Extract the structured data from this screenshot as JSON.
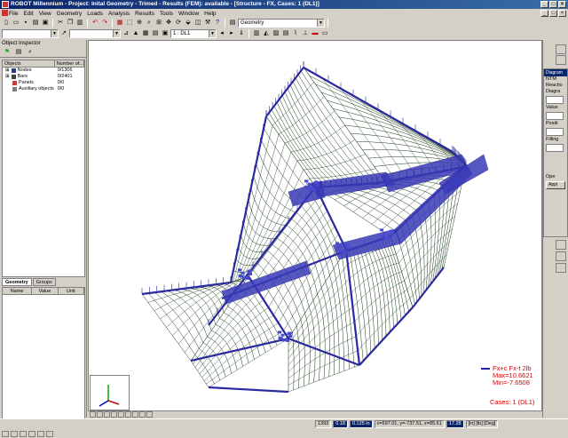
{
  "window": {
    "title": "ROBOT Millennium - Project: Inital Geometry - Trimed - Results (FEM): available - [Structure - FX, Cases: 1 (DL1)]",
    "controls": [
      "_",
      "□",
      "×"
    ]
  },
  "menu": {
    "items": [
      "File",
      "Edit",
      "View",
      "Geometry",
      "Loads",
      "Analysis",
      "Results",
      "Tools",
      "Window",
      "Help"
    ]
  },
  "toolbar": {
    "layout_select": "Geometry",
    "case_select": "1 : DL1"
  },
  "object_inspector": {
    "title": "Object Inspector",
    "columns": [
      "Objects",
      "Number of..."
    ],
    "rows": [
      {
        "name": "Nodes",
        "count": "0/1306",
        "icon_color": "#2040a0"
      },
      {
        "name": "Bars",
        "count": "0/2401",
        "icon_color": "#404040"
      },
      {
        "name": "Panels",
        "count": "0/0",
        "icon_color": "#c04040"
      },
      {
        "name": "Auxiliary objects",
        "count": "0/0",
        "icon_color": "#808080"
      }
    ],
    "tabs": [
      "Geometry",
      "Groups"
    ],
    "active_tab": "Geometry",
    "props_columns": [
      "Name",
      "Value",
      "Unit"
    ]
  },
  "legend": {
    "line1": "Fx+c Fx-t  2lb",
    "max": "Max=10.6621",
    "min": "Min=-7.6508",
    "cases": "Cases: 1 (DL1)",
    "color": "#d00000"
  },
  "right_dialog": {
    "title": "Diagram",
    "lines": [
      "NTM",
      "Reactio",
      "Diagra",
      "Value",
      "Positi",
      "Filling"
    ],
    "open": "Ope",
    "apply": "Appl"
  },
  "statusbar": {
    "fields": [
      "1393",
      "0.18",
      "0.125 in",
      "x=697.01, y=-737.51, z=85.61",
      "17.28",
      "[in] [lb] [Deg]"
    ]
  },
  "colors": {
    "structure": "#2a2aa0",
    "mesh": "#1a3a1a",
    "accent": "#0a246a"
  }
}
